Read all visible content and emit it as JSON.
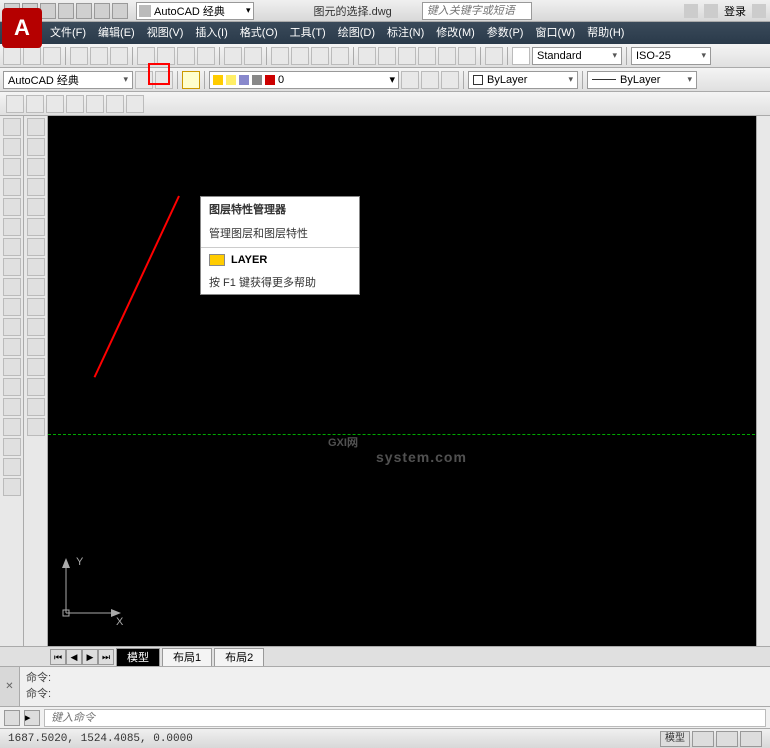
{
  "title": {
    "workspace": "AutoCAD 经典",
    "document": "图元的选择.dwg",
    "search_placeholder": "键入关键字或短语",
    "login": "登录"
  },
  "menu": [
    "文件(F)",
    "编辑(E)",
    "视图(V)",
    "插入(I)",
    "格式(O)",
    "工具(T)",
    "绘图(D)",
    "标注(N)",
    "修改(M)",
    "参数(P)",
    "窗口(W)",
    "帮助(H)"
  ],
  "styles": {
    "text_style": "Standard",
    "dim_style": "ISO-25"
  },
  "workspace_row": {
    "label": "AutoCAD 经典"
  },
  "layer": {
    "current": "0",
    "color_prop": "ByLayer",
    "linetype": "ByLayer"
  },
  "tooltip": {
    "title": "图层特性管理器",
    "desc": "管理图层和图层特性",
    "cmd": "LAYER",
    "help": "按 F1 键获得更多帮助"
  },
  "watermark": {
    "main": "GXI网",
    "sub": "system.com"
  },
  "ucs": {
    "x": "X",
    "y": "Y"
  },
  "tabs": {
    "model": "模型",
    "layout1": "布局1",
    "layout2": "布局2"
  },
  "cmd": {
    "line1": "命令:",
    "line2": "命令:",
    "input_placeholder": "键入命令"
  },
  "status": {
    "coords": "1687.5020, 1524.4085, 0.0000",
    "model_btn": "模型"
  }
}
